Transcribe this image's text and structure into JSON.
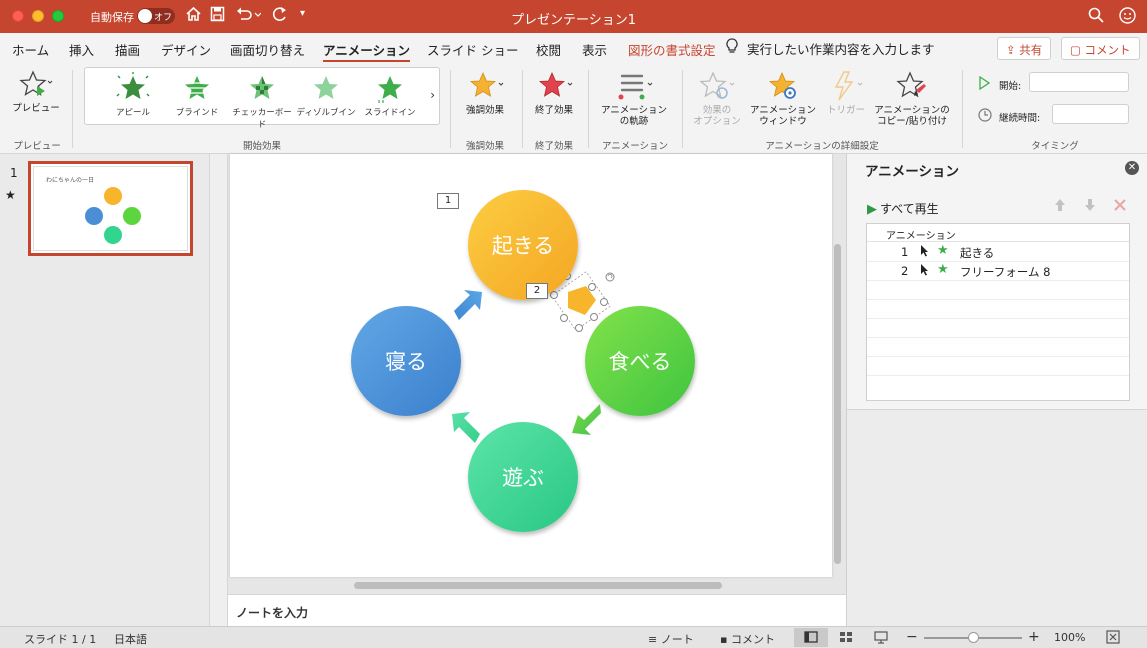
{
  "titlebar": {
    "autosave_label": "自動保存",
    "autosave_state": "オフ",
    "document_title": "プレゼンテーション1"
  },
  "menu": {
    "tabs": [
      "ホーム",
      "挿入",
      "描画",
      "デザイン",
      "画面切り替え",
      "アニメーション",
      "スライド ショー",
      "校閲",
      "表示",
      "図形の書式設定"
    ],
    "active_tab": "アニメーション",
    "tell_me": "実行したい作業内容を入力します",
    "share_label": "共有",
    "comment_label": "コメント"
  },
  "ribbon": {
    "preview_label": "プレビュー",
    "preview_group": "プレビュー",
    "gallery_items": [
      "アピール",
      "ブラインド",
      "チェッカーボード",
      "ディゾルブイン",
      "スライドイン"
    ],
    "entrance_group": "開始効果",
    "emphasis_label": "強調効果",
    "emphasis_group": "強調効果",
    "exit_label": "終了効果",
    "exit_group": "終了効果",
    "motion_label_1": "アニメーション",
    "motion_label_2": "の軌跡",
    "motion_group": "アニメーション",
    "effect_options_1": "効果の",
    "effect_options_2": "オプション",
    "anim_window_1": "アニメーション",
    "anim_window_2": "ウィンドウ",
    "trigger_label": "トリガー",
    "anim_painter_1": "アニメーションの",
    "anim_painter_2": "コピー/貼り付け",
    "advanced_group": "アニメーションの詳細設定",
    "start_label": "開始:",
    "duration_label": "継続時間:",
    "timing_group": "タイミング"
  },
  "thumbnails": {
    "slide_number": "1",
    "animation_marker": "★",
    "title": "わにちゃんの一日"
  },
  "slide": {
    "circles": {
      "wake": "起きる",
      "eat": "食べる",
      "play": "遊ぶ",
      "sleep": "寝る"
    },
    "tag_1": "1",
    "tag_2": "2"
  },
  "notes": {
    "placeholder": "ノートを入力"
  },
  "animation_pane": {
    "title": "アニメーション",
    "play_all": "すべて再生",
    "list_header": "アニメーション",
    "items": [
      {
        "num": "1",
        "name": "起きる"
      },
      {
        "num": "2",
        "name": "フリーフォーム 8"
      }
    ]
  },
  "statusbar": {
    "slide_info": "スライド 1 / 1",
    "language": "日本語",
    "notes_label": "ノート",
    "comments_label": "コメント",
    "zoom": "100%",
    "zoom_level": 0.5
  },
  "colors": {
    "accent": "#c6452f",
    "wake": "#f7b52c",
    "eat": "#5cd63c",
    "play": "#33d490",
    "sleep": "#4a8fd6"
  }
}
